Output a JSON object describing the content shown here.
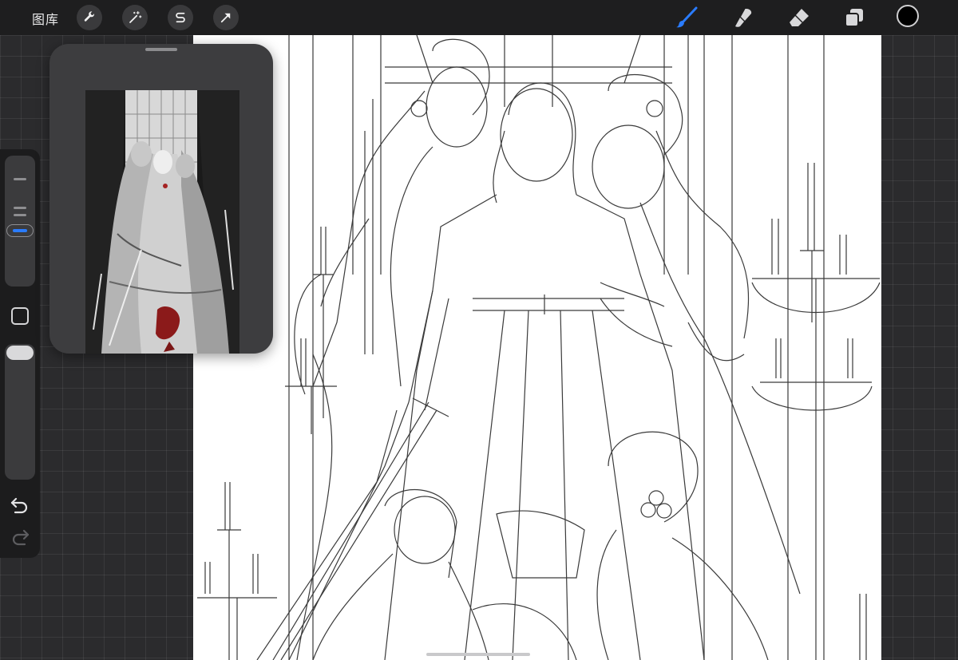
{
  "topbar": {
    "gallery_label": "图库",
    "left_tools": [
      {
        "name": "actions",
        "icon": "wrench-icon"
      },
      {
        "name": "adjustments",
        "icon": "magic-wand-icon"
      },
      {
        "name": "selection",
        "icon": "selection-s-icon"
      },
      {
        "name": "transform",
        "icon": "arrow-cursor-icon"
      }
    ],
    "right_tools": [
      {
        "name": "brush",
        "icon": "brush-icon",
        "active": true
      },
      {
        "name": "smudge",
        "icon": "smudge-icon"
      },
      {
        "name": "eraser",
        "icon": "eraser-icon"
      },
      {
        "name": "layers",
        "icon": "layers-icon"
      }
    ],
    "active_color": "#000000",
    "accent_color": "#2a7cff"
  },
  "sidebar": {
    "brush_size_level": 0.62,
    "opacity_level": 1.0,
    "buttons": [
      "modify-button",
      "undo-button",
      "redo-button"
    ]
  },
  "reference": {
    "icon": "reference-window",
    "image": "grayscale-colored-sketch-thumbnail"
  },
  "canvas": {
    "content": "pencil-lineart-illustration"
  }
}
